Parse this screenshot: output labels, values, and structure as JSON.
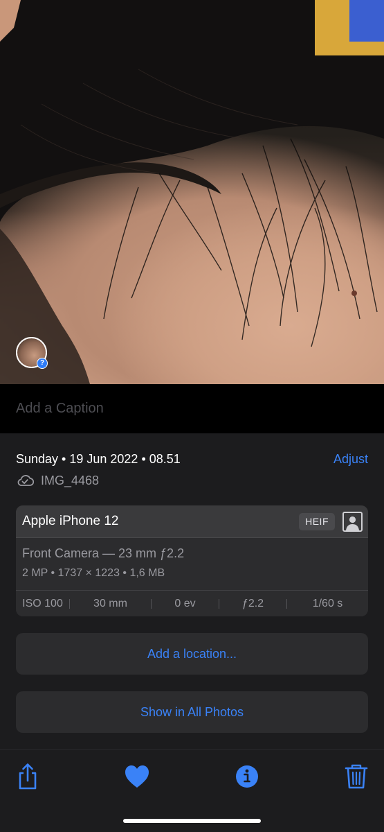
{
  "photo": {
    "face_badge_symbol": "?"
  },
  "caption": {
    "placeholder": "Add a Caption"
  },
  "info": {
    "date_line": "Sunday • 19 Jun 2022 • 08.51",
    "adjust_label": "Adjust",
    "file_name": "IMG_4468",
    "cloud_icon": "cloud-check-icon"
  },
  "camera": {
    "device": "Apple iPhone 12",
    "format_badge": "HEIF",
    "lens": "Front Camera — 23 mm ƒ2.2",
    "specs": "2 MP  •  1737 × 1223  •  1,6 MB",
    "exif": {
      "iso": "ISO 100",
      "focal": "30 mm",
      "ev": "0 ev",
      "aperture": "ƒ2.2",
      "shutter": "1/60 s"
    }
  },
  "actions": {
    "add_location": "Add a location...",
    "show_all": "Show in All Photos"
  },
  "toolbar": {
    "share_icon": "share-icon",
    "favorite_icon": "heart-icon",
    "info_icon": "info-icon",
    "delete_icon": "trash-icon"
  },
  "colors": {
    "accent": "#3a82f7",
    "panel": "#1c1c1e",
    "card": "#2c2c2e"
  }
}
